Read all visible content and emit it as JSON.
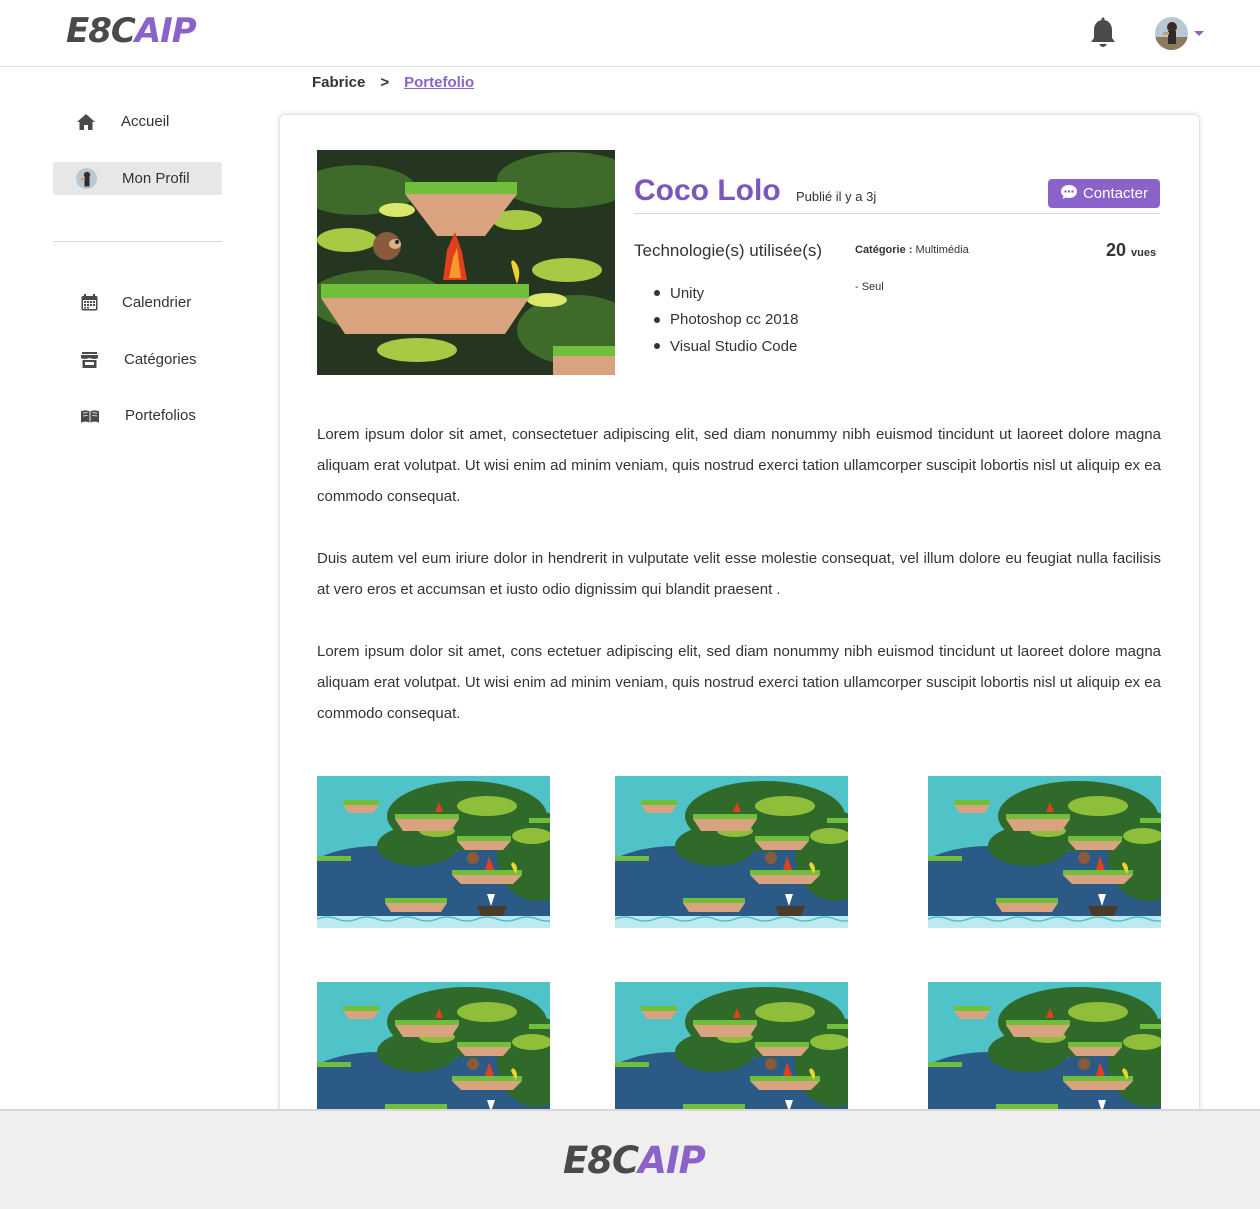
{
  "brand": {
    "logo_part1": "E8C",
    "logo_part2": "AIP"
  },
  "header": {
    "notifications_icon": "bell-icon",
    "avatar_icon": "user-avatar"
  },
  "sidebar": {
    "items": [
      {
        "label": "Accueil",
        "icon": "home-icon"
      },
      {
        "label": "Mon Profil",
        "icon": "avatar"
      },
      {
        "label": "Calendrier",
        "icon": "calendar-icon"
      },
      {
        "label": "Catégories",
        "icon": "store-icon"
      },
      {
        "label": "Portefolios",
        "icon": "book-icon"
      }
    ]
  },
  "breadcrumb": {
    "user": "Fabrice",
    "separator": ">",
    "current": "Portefolio"
  },
  "project": {
    "title": "Coco Lolo",
    "published": "Publié il y a 3j",
    "contact_label": "Contacter",
    "tech_title": "Technologie(s) utilisée(s)",
    "technologies": [
      "Unity",
      "Photoshop cc 2018",
      "Visual Studio Code"
    ],
    "category_label": "Catégorie :",
    "category_value": "Multimédia",
    "team": "-  Seul",
    "views_count": "20",
    "views_label": "vues",
    "paragraphs": [
      "Lorem ipsum dolor sit amet, consectetuer adipiscing elit, sed diam nonummy nibh euismod tincidunt ut laoreet dolore magna aliquam erat volutpat. Ut wisi enim ad minim veniam, quis nostrud exerci tation ullamcorper suscipit lobortis nisl ut aliquip ex ea commodo consequat.",
      "Duis autem vel eum iriure dolor in hendrerit in vulputate velit esse molestie consequat, vel illum dolore eu feugiat nulla facilisis at vero eros et accumsan et iusto odio dignissim qui blandit praesent .",
      "Lorem ipsum dolor sit amet, cons ectetuer adipiscing elit, sed diam nonummy nibh euismod tincidunt ut laoreet dolore magna aliquam erat volutpat. Ut wisi enim ad minim veniam, quis nostrud exerci tation ullamcorper suscipit lobortis nisl ut aliquip ex ea commodo consequat."
    ]
  },
  "colors": {
    "accent": "#8a62c9",
    "title": "#7c56b8",
    "footer_bg": "#efefef"
  }
}
